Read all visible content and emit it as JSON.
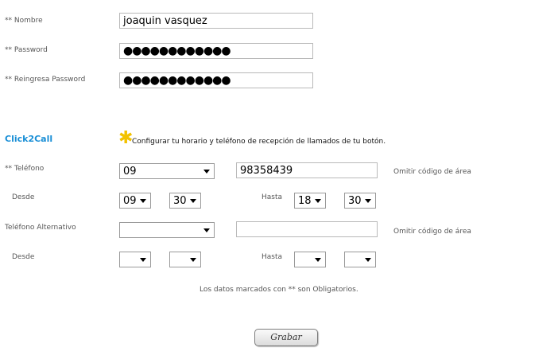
{
  "form": {
    "nombre_label": "** Nombre",
    "nombre_value": "joaquin vasquez",
    "password_label": "** Password",
    "password_value": "●●●●●●●●●●●●",
    "repassword_label": "** Reingresa Password",
    "repassword_value": "●●●●●●●●●●●●"
  },
  "click2call": {
    "title": "Click2Call",
    "note_icon": "asterisk-icon",
    "note_text": "Configurar tu horario y teléfono de recepción de llamados de tu botón.",
    "telefono_label": "** Teléfono",
    "area_code_value": "09",
    "telefono_value": "98358439",
    "omit_area_hint": "Omitir código de área",
    "desde_label": "Desde",
    "hasta_label": "Hasta",
    "desde_hour": "09",
    "desde_min": "30",
    "hasta_hour": "18",
    "hasta_min": "30",
    "alt_telefono_label": "Teléfono Alternativo",
    "alt_area_code_value": "",
    "alt_telefono_value": "",
    "alt_omit_area_hint": "Omitir código de área",
    "alt_desde_label": "Desde",
    "alt_hasta_label": "Hasta",
    "alt_desde_hour": "",
    "alt_desde_min": "",
    "alt_hasta_hour": "",
    "alt_hasta_min": ""
  },
  "footer": {
    "required_note": "Los datos marcados con ** son Obligatorios.",
    "save_label": "Grabar"
  },
  "colors": {
    "title_color": "#1a8fd6",
    "asterisk_color": "#f2c200"
  }
}
